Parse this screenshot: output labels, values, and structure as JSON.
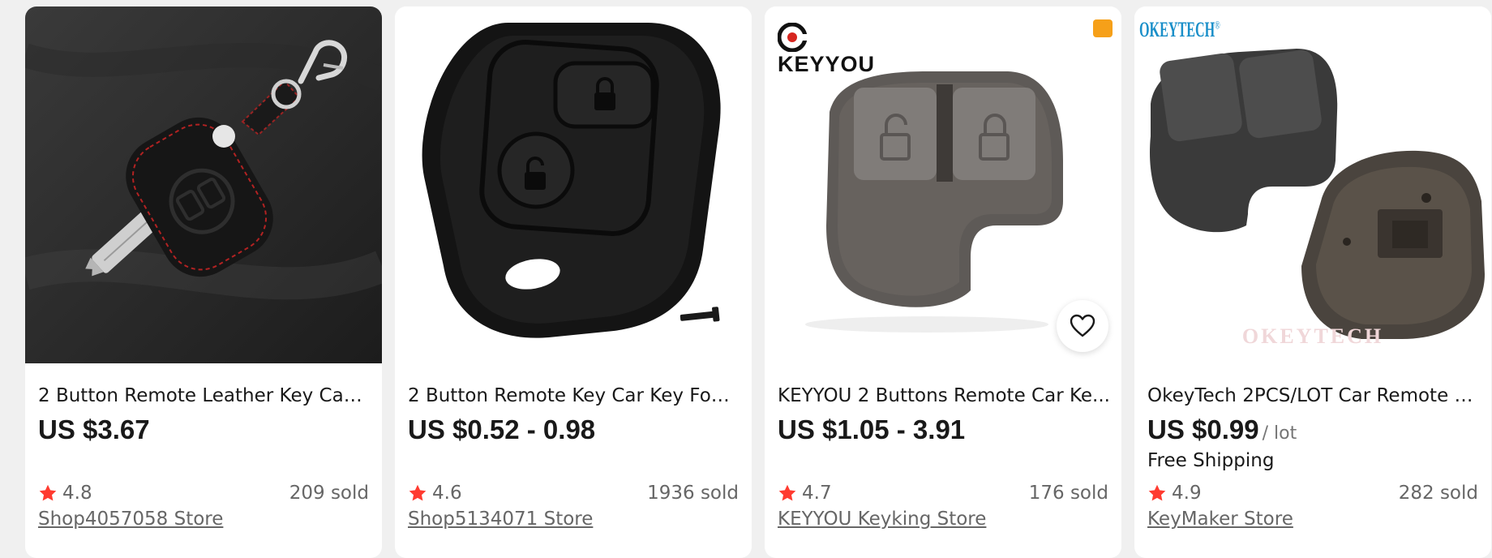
{
  "products": [
    {
      "title": "2 Button Remote Leather Key Case...",
      "price": "US $3.67",
      "unit": "",
      "shipping": "",
      "rating": "4.8",
      "sold": "209 sold",
      "store": "Shop4057058 Store"
    },
    {
      "title": "2 Button Remote Key Car Key Fob ...",
      "price": "US $0.52 - 0.98",
      "unit": "",
      "shipping": "",
      "rating": "4.6",
      "sold": "1936 sold",
      "store": "Shop5134071 Store"
    },
    {
      "title": "KEYYOU 2 Buttons Remote Car Ke...",
      "price": "US $1.05 - 3.91",
      "unit": "",
      "shipping": "",
      "rating": "4.7",
      "sold": "176 sold",
      "store": "KEYYOU Keyking Store",
      "brand_logo": "KEYYOU"
    },
    {
      "title": "OkeyTech 2PCS/LOT Car Remote K...",
      "price": "US $0.99",
      "unit": "/ lot",
      "shipping": "Free Shipping",
      "rating": "4.9",
      "sold": "282 sold",
      "store": "KeyMaker Store",
      "brand_logo": "OKEYTECH",
      "watermark": "OKEYTECH"
    }
  ],
  "icons": {
    "star": "star-icon",
    "wishlist": "heart-icon",
    "badge": "store-badge-icon"
  },
  "colors": {
    "star": "#ff3b30",
    "price": "#191919",
    "muted": "#666666",
    "brand_blue": "#1a8fc9"
  }
}
